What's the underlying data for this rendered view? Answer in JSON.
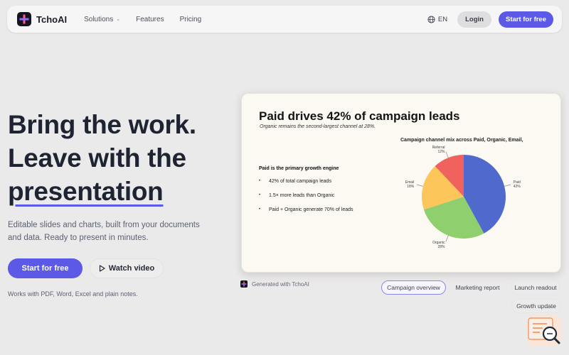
{
  "nav": {
    "brand": "TchoAI",
    "menu": [
      "Solutions",
      "Features",
      "Pricing"
    ],
    "lang": "EN",
    "login": "Login",
    "start": "Start for free"
  },
  "hero": {
    "title_line1": "Bring the work.",
    "title_line2": "Leave with the",
    "title_line3": "presentation",
    "subtitle": "Editable slides and charts, built from your documents and data. Ready to present in minutes.",
    "cta_start": "Start for free",
    "cta_video": "Watch video",
    "works_with": "Works with PDF, Word, Excel and plain notes."
  },
  "slide": {
    "title": "Paid drives 42% of campaign leads",
    "subtitle": "Organic remains the second-largest channel at 28%.",
    "heading": "Paid is the primary growth engine",
    "bullets": [
      "42% of total campaign leads",
      "1.5× more leads than Organic",
      "Paid + Organic generate 70% of leads"
    ]
  },
  "chart_data": {
    "type": "pie",
    "title": "Campaign channel mix across Paid, Organic, Email,",
    "categories": [
      "Paid",
      "Organic",
      "Email",
      "Referral"
    ],
    "values": [
      42,
      28,
      18,
      12
    ],
    "labels": [
      "42%",
      "28%",
      "18%",
      "12%"
    ],
    "colors": [
      "#5069cd",
      "#8fcf6e",
      "#fcc65a",
      "#f0625e"
    ]
  },
  "footer": {
    "generated": "Generated with TchoAI",
    "chips": [
      "Campaign overview",
      "Marketing report",
      "Launch readout",
      "Growth update"
    ]
  },
  "colors": {
    "accent": "#5b59e6",
    "background": "#ebeaea"
  }
}
